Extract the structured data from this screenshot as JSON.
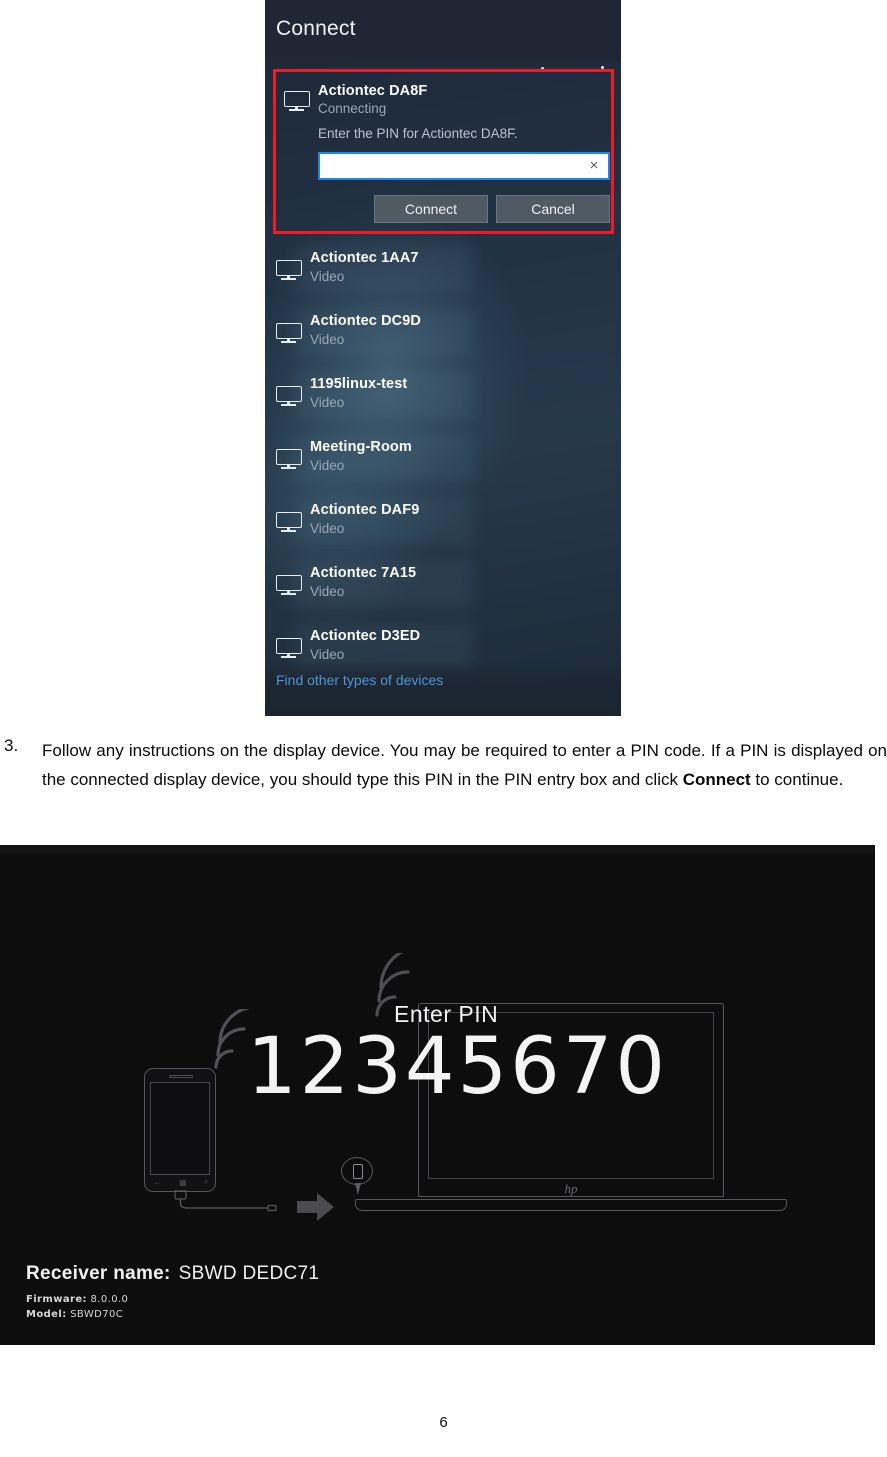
{
  "connect_panel": {
    "title": "Connect",
    "connecting_device": {
      "icon": "monitor-icon",
      "name": "Actiontec DA8F",
      "status": "Connecting",
      "pin_prompt": "Enter the PIN for Actiontec DA8F.",
      "pin_value": "",
      "pin_placeholder": "",
      "clear_icon": "×",
      "connect_label": "Connect",
      "cancel_label": "Cancel",
      "highlight_color": "#ed1c24",
      "input_focus_color": "#1f87e5"
    },
    "devices": [
      {
        "icon": "monitor-icon",
        "name": "Actiontec 1AA7",
        "type": "Video"
      },
      {
        "icon": "monitor-icon",
        "name": "Actiontec DC9D",
        "type": "Video"
      },
      {
        "icon": "monitor-icon",
        "name": "1195linux-test",
        "type": "Video"
      },
      {
        "icon": "monitor-icon",
        "name": "Meeting-Room",
        "type": "Video"
      },
      {
        "icon": "monitor-icon",
        "name": "Actiontec DAF9",
        "type": "Video"
      },
      {
        "icon": "monitor-icon",
        "name": "Actiontec 7A15",
        "type": "Video"
      },
      {
        "icon": "monitor-icon",
        "name": "Actiontec D3ED",
        "type": "Video"
      }
    ],
    "find_other_link": "Find other types of devices",
    "link_color": "#5294d6",
    "background_color": "#1e2a38"
  },
  "instruction": {
    "number": "3.",
    "part1": "Follow any instructions on the display device. You may be required to enter a PIN code. If a PIN is displayed on the connected display device, you should type this PIN in the PIN entry box and click ",
    "bold": "Connect",
    "part2": " to continue."
  },
  "receiver_screen": {
    "enter_pin_label": "Enter PIN",
    "pin_code": "12345670",
    "laptop_brand": "hp",
    "receiver_name_label": "Receiver name:",
    "receiver_name_value": "SBWD DEDC71",
    "firmware_label": "Firmware:",
    "firmware_value": "8.0.0.0",
    "model_label": "Model:",
    "model_value": "SBWD70C",
    "background_color": "#0d0d0d",
    "phone_nav_icons": [
      "←",
      "▦",
      "⌕"
    ]
  },
  "page_number": "6"
}
